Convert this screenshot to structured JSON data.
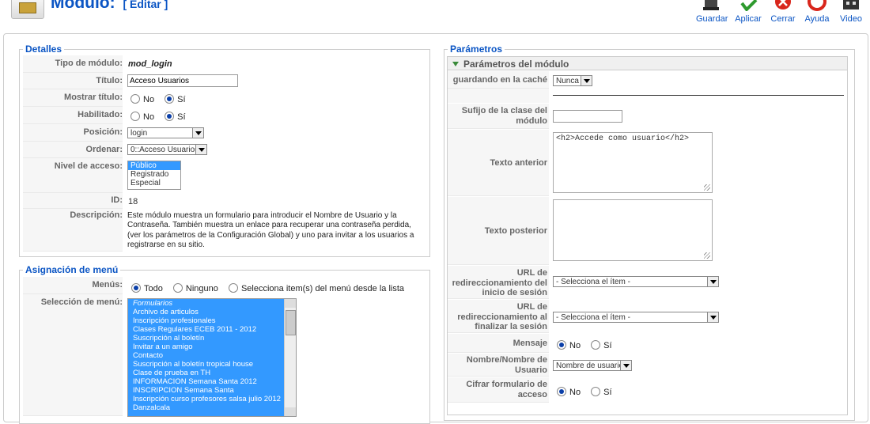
{
  "header": {
    "title": "Módulo:",
    "edit_label": "[ Editar ]"
  },
  "toolbar": {
    "save": "Guardar",
    "apply": "Aplicar",
    "close": "Cerrar",
    "help": "Ayuda",
    "video": "Video"
  },
  "details": {
    "legend": "Detalles",
    "module_type_label": "Tipo de módulo:",
    "module_type_value": "mod_login",
    "title_label": "Título:",
    "title_value": "Acceso Usuarios",
    "show_title_label": "Mostrar título:",
    "enabled_label": "Habilitado:",
    "no": "No",
    "yes": "Sí",
    "position_label": "Posición:",
    "position_value": "login",
    "order_label": "Ordenar:",
    "order_value": "0::Acceso Usuarios",
    "access_label": "Nivel de acceso:",
    "access_options": [
      "Público",
      "Registrado",
      "Especial"
    ],
    "id_label": "ID:",
    "id_value": "18",
    "description_label": "Descripción:",
    "description_value": "Este módulo muestra un formulario para introducir el Nombre de Usuario y la Contraseña. También muestra un enlace para recuperar una contraseña perdida, (ver los parámetros de la Configuración Global) y uno para invitar a los usuarios a registrarse en su sitio."
  },
  "menu_assignment": {
    "legend": "Asignación de menú",
    "menus_label": "Menús:",
    "opt_all": "Todo",
    "opt_none": "Ninguno",
    "opt_select": "Selecciona item(s) del menú desde la lista",
    "selection_label": "Selección de menú:",
    "items": [
      "Formularios",
      "Archivo de articulos",
      "Inscripción profesionales",
      "Clases Regulares ECEB 2011 - 2012",
      "Suscripción al boletín",
      "Invitar a un amigo",
      "Contacto",
      "Suscripción al boletín tropical house",
      "Clase de prueba en TH",
      "INFORMACION Semana Santa 2012",
      "INSCRIPCION Semana Santa",
      "Inscripción curso profesores salsa julio 2012",
      "Danzalcala"
    ]
  },
  "params": {
    "legend": "Parámetros",
    "section_title": "Parámetros del módulo",
    "cache_label": "guardando en la caché",
    "cache_value": "Nunca",
    "suffix_label": "Sufijo de la clase del módulo",
    "suffix_value": "",
    "pretext_label": "Texto anterior",
    "pretext_value": "<h2>Accede como usuario</h2>",
    "posttext_label": "Texto posterior",
    "posttext_value": "",
    "login_redirect_label": "URL de redireccionamiento del inicio de sesión",
    "login_redirect_value": "- Selecciona el ítem -",
    "logout_redirect_label": "URL de redireccionamiento al finalizar la sesión",
    "logout_redirect_value": "- Selecciona el ítem -",
    "message_label": "Mensaje",
    "name_label": "Nombre/Nombre de Usuario",
    "name_value": "Nombre de usuario",
    "encrypt_label": "Cifrar formulario de acceso",
    "no": "No",
    "yes": "Sí"
  }
}
